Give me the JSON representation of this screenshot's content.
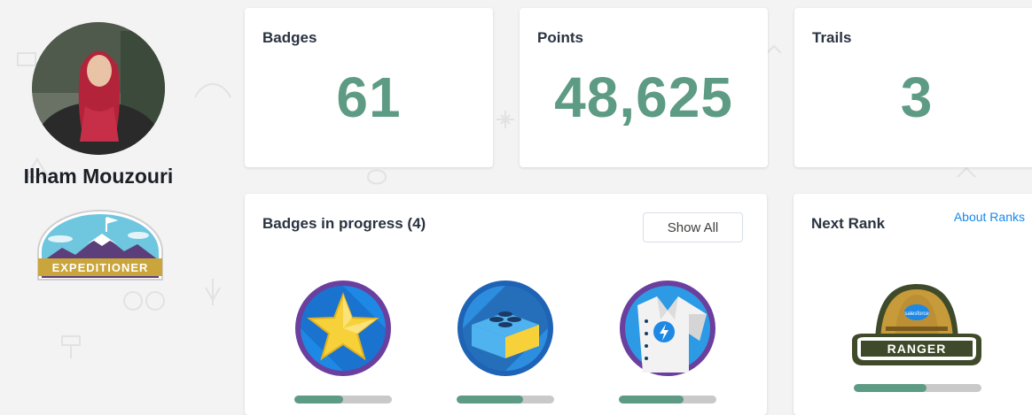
{
  "profile": {
    "name": "Ilham Mouzouri",
    "rank_label": "EXPEDITIONER"
  },
  "stats": [
    {
      "label": "Badges",
      "value": "61"
    },
    {
      "label": "Points",
      "value": "48,625"
    },
    {
      "label": "Trails",
      "value": "3"
    }
  ],
  "badges_in_progress": {
    "title": "Badges in progress (4)",
    "show_all_label": "Show All",
    "items": [
      {
        "icon": "star-badge-icon",
        "progress": 0.5
      },
      {
        "icon": "data-block-badge-icon",
        "progress": 0.68
      },
      {
        "icon": "lightning-shirt-badge-icon",
        "progress": 0.66
      }
    ]
  },
  "next_rank": {
    "title": "Next Rank",
    "about_link": "About Ranks",
    "rank_label": "RANGER",
    "brand_label": "salesforce",
    "progress": 0.57
  },
  "colors": {
    "accent_green": "#5d9b84",
    "link_blue": "#1589ee",
    "badge_purple": "#6b3f9e",
    "badge_blue": "#1e88e5"
  }
}
